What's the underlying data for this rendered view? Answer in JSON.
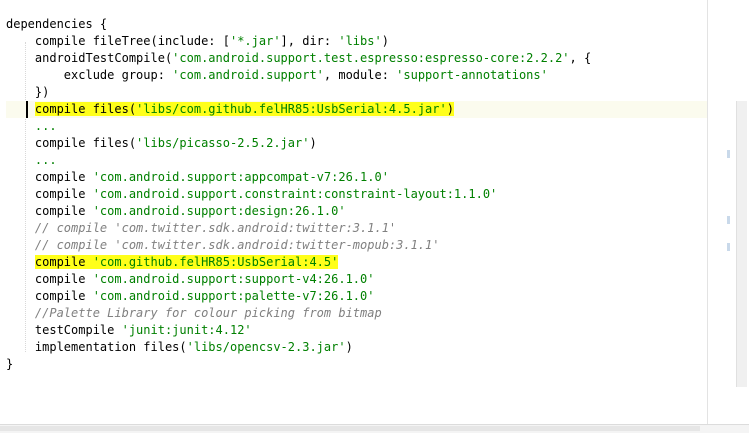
{
  "editor": {
    "lines": [
      {
        "parts": [
          {
            "text": "dependencies {",
            "cls": ""
          }
        ]
      },
      {
        "parts": [
          {
            "text": "    compile fileTree(include: [",
            "cls": ""
          },
          {
            "text": "'*.jar'",
            "cls": "str"
          },
          {
            "text": "], dir: ",
            "cls": ""
          },
          {
            "text": "'libs'",
            "cls": "str"
          },
          {
            "text": ")",
            "cls": ""
          }
        ]
      },
      {
        "parts": [
          {
            "text": "    androidTestCompile(",
            "cls": ""
          },
          {
            "text": "'com.android.support.test.espresso:espresso-core:2.2.2'",
            "cls": "str"
          },
          {
            "text": ", {",
            "cls": ""
          }
        ]
      },
      {
        "parts": [
          {
            "text": "        exclude group: ",
            "cls": ""
          },
          {
            "text": "'com.android.support'",
            "cls": "str"
          },
          {
            "text": ", module: ",
            "cls": ""
          },
          {
            "text": "'support-annotations'",
            "cls": "str"
          }
        ]
      },
      {
        "parts": [
          {
            "text": "    })",
            "cls": ""
          }
        ]
      },
      {
        "current": true,
        "parts": [
          {
            "text": "    ",
            "cls": ""
          },
          {
            "text": "compile files(",
            "cls": "hl"
          },
          {
            "text": "'libs/com.github.felHR85:UsbSerial:4.5.jar'",
            "cls": "str hl"
          },
          {
            "text": ")",
            "cls": "hl"
          }
        ]
      },
      {
        "parts": [
          {
            "text": "    ",
            "cls": ""
          },
          {
            "text": "...",
            "cls": "str"
          }
        ]
      },
      {
        "parts": [
          {
            "text": "    compile files(",
            "cls": ""
          },
          {
            "text": "'libs/picasso-2.5.2.jar'",
            "cls": "str"
          },
          {
            "text": ")",
            "cls": ""
          }
        ]
      },
      {
        "parts": [
          {
            "text": "    ",
            "cls": ""
          },
          {
            "text": "...",
            "cls": "str"
          }
        ]
      },
      {
        "parts": [
          {
            "text": "    compile ",
            "cls": ""
          },
          {
            "text": "'com.android.support:appcompat-v7:26.1.0'",
            "cls": "str"
          }
        ]
      },
      {
        "parts": [
          {
            "text": "    compile ",
            "cls": ""
          },
          {
            "text": "'com.android.support.constraint:constraint-layout:1.1.0'",
            "cls": "str"
          }
        ]
      },
      {
        "parts": [
          {
            "text": "    compile ",
            "cls": ""
          },
          {
            "text": "'com.android.support:design:26.1.0'",
            "cls": "str"
          }
        ]
      },
      {
        "parts": [
          {
            "text": "    ",
            "cls": ""
          },
          {
            "text": "// compile 'com.twitter.sdk.android:twitter:3.1.1'",
            "cls": "cmt"
          }
        ]
      },
      {
        "parts": [
          {
            "text": "    ",
            "cls": ""
          },
          {
            "text": "// compile 'com.twitter.sdk.android:twitter-mopub:3.1.1'",
            "cls": "cmt"
          }
        ]
      },
      {
        "parts": [
          {
            "text": "    ",
            "cls": ""
          },
          {
            "text": "compile ",
            "cls": "hl"
          },
          {
            "text": "'com.github.felHR85:UsbSerial:4.5'",
            "cls": "str hl"
          }
        ]
      },
      {
        "parts": [
          {
            "text": "    compile ",
            "cls": ""
          },
          {
            "text": "'com.android.support:support-v4:26.1.0'",
            "cls": "str"
          }
        ]
      },
      {
        "parts": [
          {
            "text": "    compile ",
            "cls": ""
          },
          {
            "text": "'com.android.support:palette-v7:26.1.0'",
            "cls": "str"
          }
        ]
      },
      {
        "parts": [
          {
            "text": "    ",
            "cls": ""
          },
          {
            "text": "//Palette Library for colour picking from bitmap",
            "cls": "cmt"
          }
        ]
      },
      {
        "parts": [
          {
            "text": "    testCompile ",
            "cls": ""
          },
          {
            "text": "'junit:junit:4.12'",
            "cls": "str"
          }
        ]
      },
      {
        "parts": [
          {
            "text": "    implementation files(",
            "cls": ""
          },
          {
            "text": "'libs/opencsv-2.3.jar'",
            "cls": "str"
          },
          {
            "text": ")",
            "cls": ""
          }
        ]
      },
      {
        "parts": [
          {
            "text": "}",
            "cls": ""
          }
        ]
      }
    ]
  },
  "colors": {
    "string": "#008000",
    "comment": "#808080",
    "highlight": "#ffff1a",
    "current_line": "#fbfbee"
  }
}
